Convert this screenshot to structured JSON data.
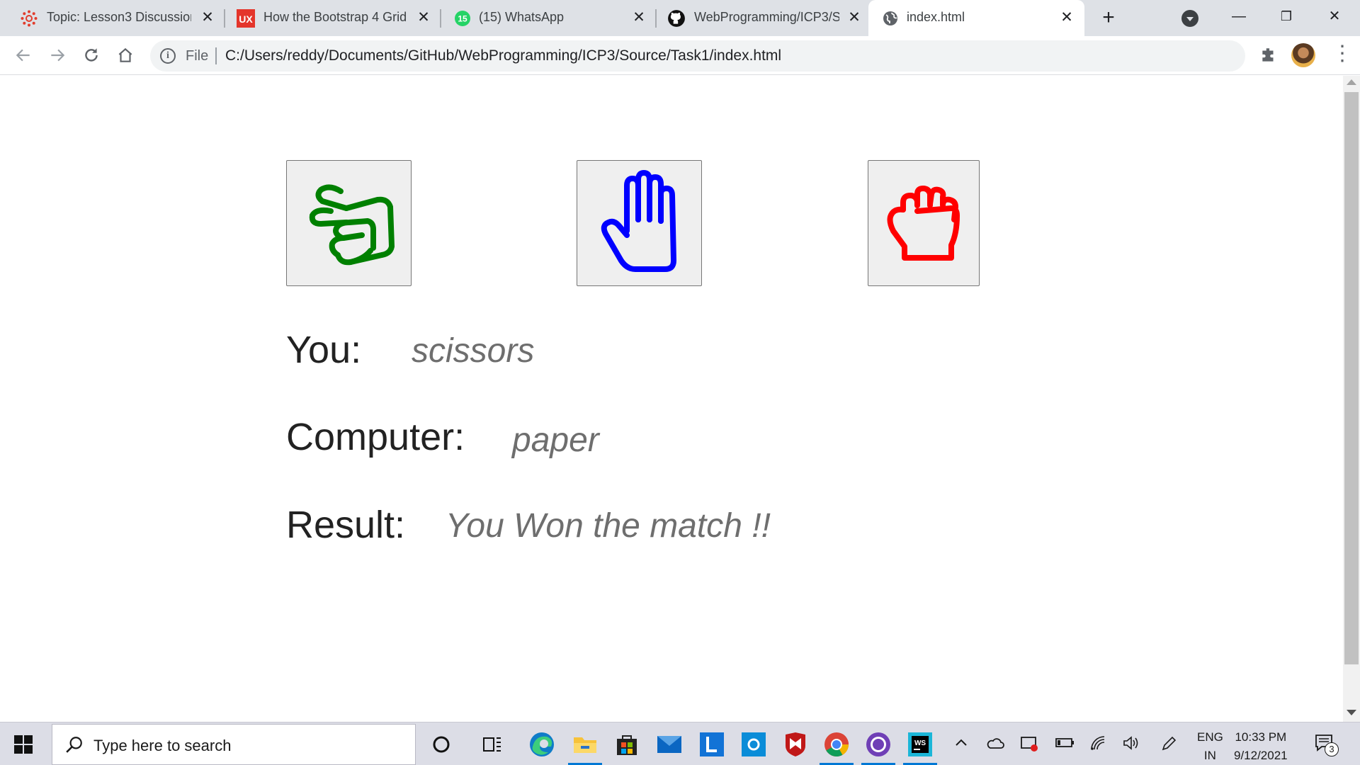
{
  "browser": {
    "tabs": [
      {
        "title": "Topic: Lesson3 Discussion",
        "favicon": "canvas-icon",
        "color": "#e13d2d"
      },
      {
        "title": "How the Bootstrap 4 Grid",
        "favicon": "ux-icon",
        "color": "#e4352b"
      },
      {
        "title": "(15) WhatsApp",
        "favicon": "whatsapp-icon",
        "badge": "15",
        "color": "#25d366"
      },
      {
        "title": "WebProgramming/ICP3/S",
        "favicon": "github-icon",
        "color": "#111111"
      },
      {
        "title": "index.html",
        "favicon": "globe-icon",
        "active": true
      }
    ],
    "newtab_label": "+",
    "window_controls": {
      "minimize": "—",
      "restore": "❐",
      "close": "✕"
    },
    "address": {
      "scheme_label": "File",
      "url": "C:/Users/reddy/Documents/GitHub/WebProgramming/ICP3/Source/Task1/index.html"
    }
  },
  "game": {
    "choices": [
      {
        "name": "scissors",
        "icon": "scissors-hand-icon",
        "color": "#008000"
      },
      {
        "name": "paper",
        "icon": "paper-hand-icon",
        "color": "#0000ff"
      },
      {
        "name": "rock",
        "icon": "rock-fist-icon",
        "color": "#ff0000"
      }
    ],
    "you_label": "You:",
    "you_value": "scissors",
    "computer_label": "Computer:",
    "computer_value": "paper",
    "result_label": "Result:",
    "result_value": "You Won the match !!"
  },
  "taskbar": {
    "search_placeholder": "Type here to search",
    "apps": [
      "cortana-icon",
      "task-view-icon",
      "edge-icon",
      "file-explorer-icon",
      "store-icon",
      "mail-icon",
      "l-app-icon",
      "photo-app-icon",
      "mcafee-icon",
      "chrome-icon",
      "github-desktop-icon",
      "webstorm-icon"
    ],
    "language_top": "ENG",
    "language_bottom": "IN",
    "time": "10:33 PM",
    "date": "9/12/2021",
    "notifications": "3"
  }
}
